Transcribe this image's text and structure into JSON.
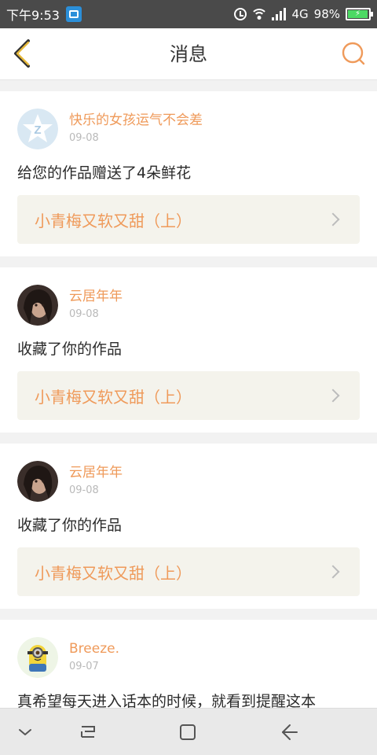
{
  "status_bar": {
    "time": "下午9:53",
    "network": "4G",
    "battery": "98%"
  },
  "header": {
    "title": "消息"
  },
  "notifications": [
    {
      "username": "快乐的女孩运气不会差",
      "date": "09-08",
      "message": "给您的作品赠送了4朵鲜花",
      "work_title": "小青梅又软又甜（上）"
    },
    {
      "username": "云居年年",
      "date": "09-08",
      "message": "收藏了你的作品",
      "work_title": "小青梅又软又甜（上）"
    },
    {
      "username": "云居年年",
      "date": "09-08",
      "message": "收藏了你的作品",
      "work_title": "小青梅又软又甜（上）"
    },
    {
      "username": "Breeze.",
      "date": "09-07",
      "message": "真希望每天进入话本的时候，就看到提醒这本"
    }
  ],
  "colors": {
    "accent": "#ef9a5a",
    "back_icon": "#e6b93a",
    "card_link_bg": "#f4f3ec"
  },
  "icons": {
    "back": "back-arrow-icon",
    "search": "search-icon",
    "nav_down": "chevron-down-icon",
    "nav_recent": "recent-apps-icon",
    "nav_home": "home-icon",
    "nav_back": "back-icon"
  }
}
